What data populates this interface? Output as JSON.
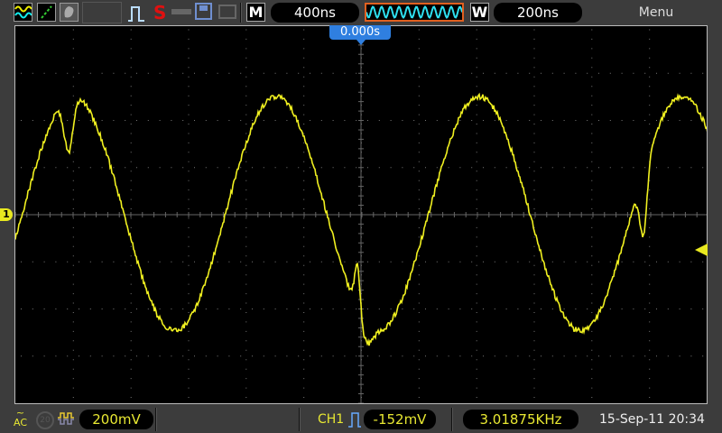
{
  "toolbar": {
    "icons": [
      "dual-wave-icon",
      "xy-mode-icon",
      "persist-icon",
      "pulse-icon",
      "single-s-icon",
      "key-icon",
      "save-disk-icon",
      "printer-icon"
    ],
    "single_label": "S",
    "main_label": "M",
    "main_timebase": "400ns",
    "window_label": "W",
    "window_timebase": "200ns",
    "menu": "Menu"
  },
  "trigger_position": "0.000s",
  "channel_marker": "1",
  "status": {
    "coupling": "AC",
    "bw_limit": "20",
    "volts_div": "200mV",
    "channel": "CH1",
    "trigger_level": "-152mV",
    "frequency": "3.01875KHz",
    "datetime": "15-Sep-11 20:34"
  },
  "colors": {
    "trace": "#f0f020",
    "accent": "#2f7fe0",
    "window_border": "#e06020"
  }
}
